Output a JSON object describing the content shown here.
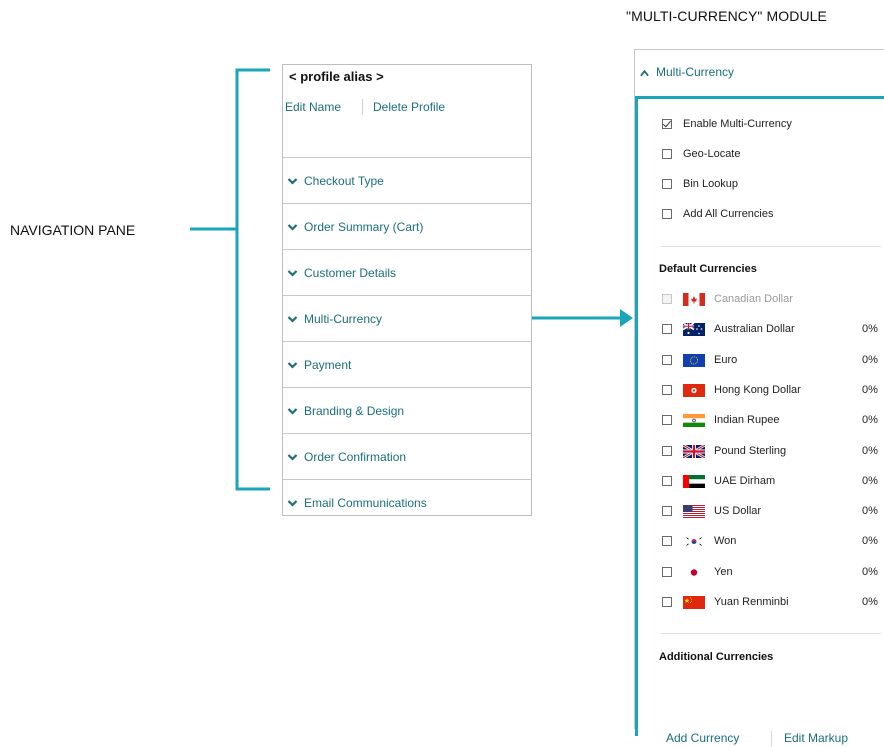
{
  "callouts": {
    "module_title": "\"MULTI-CURRENCY\" MODULE",
    "nav_label": "NAVIGATION PANE",
    "accent_color": "#1aa5b8"
  },
  "nav_pane": {
    "alias": "< profile alias >",
    "edit_name": "Edit Name",
    "delete_profile": "Delete Profile",
    "items": [
      {
        "label": "Checkout Type",
        "icon": "chevron-down-icon"
      },
      {
        "label": "Order Summary (Cart)",
        "icon": "chevron-down-icon"
      },
      {
        "label": "Customer Details",
        "icon": "chevron-down-icon"
      },
      {
        "label": "Multi-Currency",
        "icon": "chevron-down-icon"
      },
      {
        "label": "Payment",
        "icon": "chevron-down-icon"
      },
      {
        "label": "Branding & Design",
        "icon": "chevron-down-icon"
      },
      {
        "label": "Order Confirmation",
        "icon": "chevron-down-icon"
      },
      {
        "label": "Email Communications",
        "icon": "chevron-down-icon"
      }
    ],
    "link_color": "#1a6f7a"
  },
  "module": {
    "header": "Multi-Currency",
    "header_icon": "chevron-up-icon",
    "options": [
      {
        "label": "Enable Multi-Currency",
        "checked": true
      },
      {
        "label": "Geo-Locate",
        "checked": false
      },
      {
        "label": "Bin Lookup",
        "checked": false
      },
      {
        "label": "Add All Currencies",
        "checked": false
      }
    ],
    "default_currencies_title": "Default Currencies",
    "currencies": [
      {
        "name": "Canadian Dollar",
        "flag": "canada-flag-icon",
        "percent": "",
        "disabled": true,
        "checked": false
      },
      {
        "name": "Australian Dollar",
        "flag": "australia-flag-icon",
        "percent": "0%",
        "disabled": false,
        "checked": false
      },
      {
        "name": "Euro",
        "flag": "eu-flag-icon",
        "percent": "0%",
        "disabled": false,
        "checked": false
      },
      {
        "name": "Hong Kong Dollar",
        "flag": "hong-kong-flag-icon",
        "percent": "0%",
        "disabled": false,
        "checked": false
      },
      {
        "name": "Indian Rupee",
        "flag": "india-flag-icon",
        "percent": "0%",
        "disabled": false,
        "checked": false
      },
      {
        "name": "Pound Sterling",
        "flag": "uk-flag-icon",
        "percent": "0%",
        "disabled": false,
        "checked": false
      },
      {
        "name": "UAE Dirham",
        "flag": "uae-flag-icon",
        "percent": "0%",
        "disabled": false,
        "checked": false
      },
      {
        "name": "US Dollar",
        "flag": "us-flag-icon",
        "percent": "0%",
        "disabled": false,
        "checked": false
      },
      {
        "name": "Won",
        "flag": "south-korea-flag-icon",
        "percent": "0%",
        "disabled": false,
        "checked": false
      },
      {
        "name": "Yen",
        "flag": "japan-flag-icon",
        "percent": "0%",
        "disabled": false,
        "checked": false
      },
      {
        "name": "Yuan Renminbi",
        "flag": "china-flag-icon",
        "percent": "0%",
        "disabled": false,
        "checked": false
      }
    ],
    "additional_currencies_title": "Additional Currencies",
    "add_currency": "Add Currency",
    "edit_markup": "Edit Markup"
  }
}
